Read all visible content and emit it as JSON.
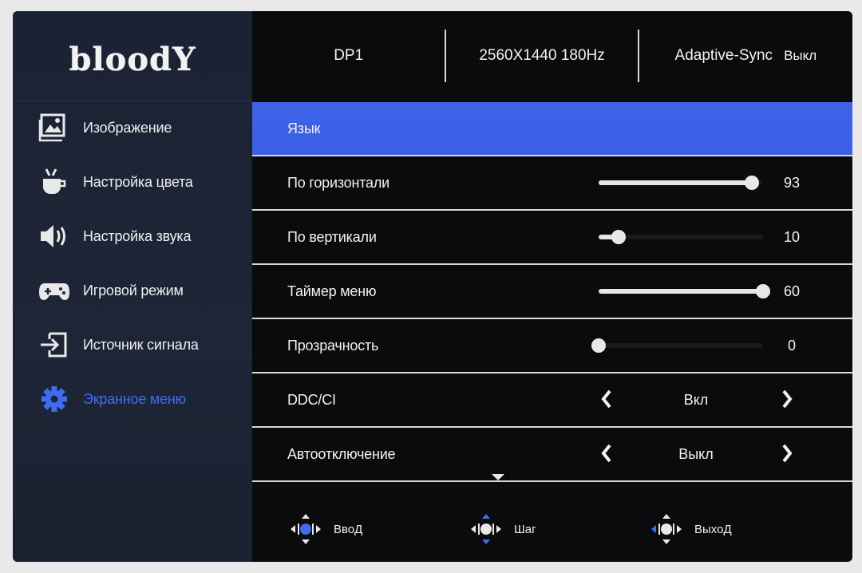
{
  "brand": "bloodY",
  "header": {
    "input": "DP1",
    "resolution": "2560X1440 180Hz",
    "sync_label": "Adaptive-Sync",
    "sync_value": "Выкл"
  },
  "sidebar": {
    "items": [
      {
        "label": "Изображение",
        "icon": "image-icon"
      },
      {
        "label": "Настройка цвета",
        "icon": "color-icon"
      },
      {
        "label": "Настройка звука",
        "icon": "speaker-icon"
      },
      {
        "label": "Игровой режим",
        "icon": "gamepad-icon"
      },
      {
        "label": "Источник сигнала",
        "icon": "input-source-icon"
      },
      {
        "label": "Экранное меню",
        "icon": "gear-icon"
      }
    ],
    "active_index": 5
  },
  "menu": {
    "rows": [
      {
        "label": "Язык",
        "kind": "header"
      },
      {
        "label": "По горизонтали",
        "kind": "slider",
        "value": 93,
        "fraction": 0.93
      },
      {
        "label": "По вертикали",
        "kind": "slider",
        "value": 10,
        "fraction": 0.12
      },
      {
        "label": "Таймер меню",
        "kind": "slider",
        "value": 60,
        "fraction": 1.0
      },
      {
        "label": "Прозрачность",
        "kind": "slider",
        "value": 0,
        "fraction": 0.0
      },
      {
        "label": "DDC/CI",
        "kind": "choice",
        "value": "Вкл"
      },
      {
        "label": "Автоотключение",
        "kind": "choice",
        "value": "Выкл"
      }
    ]
  },
  "footer": {
    "enter": "ВвоД",
    "step": "Шаг",
    "exit": "ВыхоД"
  },
  "colors": {
    "accent": "#3f6cf5",
    "selected_row": "#3e63e8",
    "sidebar": "#1d2537",
    "background": "#0b0b0e"
  }
}
